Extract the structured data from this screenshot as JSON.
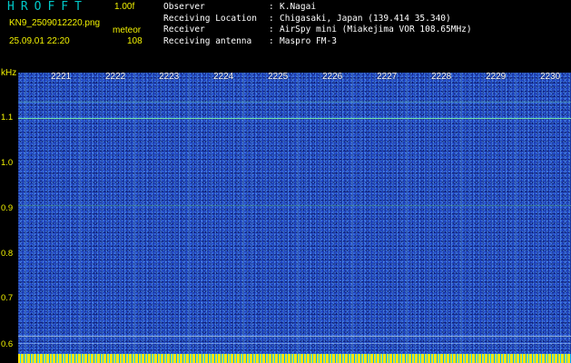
{
  "header": {
    "title": "HROFFT",
    "version": "1.00f",
    "filename": "KN9_2509012220.png",
    "mode": "meteor",
    "timestamp": "25.09.01 22:20",
    "count": "108"
  },
  "meta": {
    "rows": [
      {
        "key": "Observer",
        "sep": ":",
        "value": "K.Nagai"
      },
      {
        "key": "Receiving Location",
        "sep": ":",
        "value": "Chigasaki, Japan (139.414 35.340)"
      },
      {
        "key": "Receiver",
        "sep": ":",
        "value": "AirSpy mini (Miakejima VOR 108.65MHz)"
      },
      {
        "key": "Receiving antenna",
        "sep": ":",
        "value": "Maspro FM-3"
      }
    ]
  },
  "axis": {
    "unit": "kHz",
    "y_labels": [
      "1.1",
      "1.0",
      "0.9",
      "0.8",
      "0.7",
      "0.6"
    ],
    "x_labels": [
      "2221",
      "2222",
      "2223",
      "2224",
      "2225",
      "2226",
      "2227",
      "2228",
      "2229",
      "2230"
    ]
  },
  "colors": {
    "background": "#000000",
    "title": "#00c8c8",
    "header_text": "#f2f200",
    "meta_text": "#ffffff",
    "spectrum": "#1a3dc4",
    "signal_line": "#7fffb0"
  }
}
